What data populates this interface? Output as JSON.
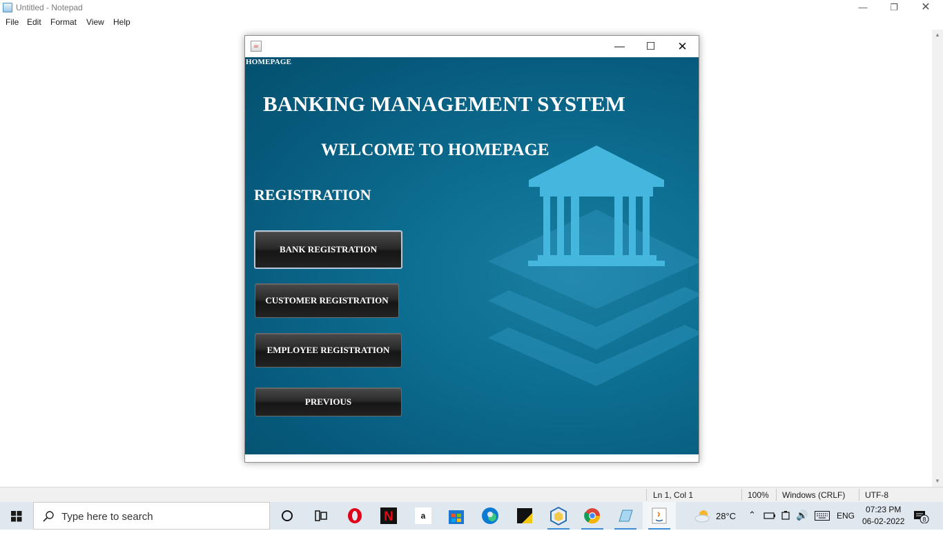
{
  "notepad": {
    "title": "Untitled - Notepad",
    "menu": [
      "File",
      "Edit",
      "Format",
      "View",
      "Help"
    ],
    "status": {
      "position": "Ln 1, Col 1",
      "zoom": "100%",
      "line_endings": "Windows (CRLF)",
      "encoding": "UTF-8"
    }
  },
  "java_window": {
    "panel_tag": "HOMEPAGE",
    "system_title": "BANKING MANAGEMENT SYSTEM",
    "welcome_title": "WELCOME TO HOMEPAGE",
    "section_title": "REGISTRATION",
    "buttons": {
      "bank": "BANK REGISTRATION",
      "customer": "CUSTOMER REGISTRATION",
      "employee": "EMPLOYEE REGISTRATION",
      "previous": "PREVIOUS"
    }
  },
  "taskbar": {
    "search_placeholder": "Type here to search",
    "apps": [
      "cortana-icon",
      "task-view-icon",
      "opera-icon",
      "netflix-icon",
      "amazon-icon",
      "microsoft-store-icon",
      "edge-icon",
      "sticky-notes-icon",
      "virtualbox-icon",
      "chrome-icon",
      "notepad-icon",
      "java-icon"
    ],
    "amazon_glyph": "a",
    "weather_temp": "28°C",
    "language": "ENG",
    "time": "07:23 PM",
    "date": "06-02-2022",
    "notification_count": "8"
  },
  "colors": {
    "panel_bg": "#0d6f92",
    "bank_icon": "#45b6de",
    "button_bg": "#222222",
    "taskbar_bg": "#dfe7ef"
  }
}
